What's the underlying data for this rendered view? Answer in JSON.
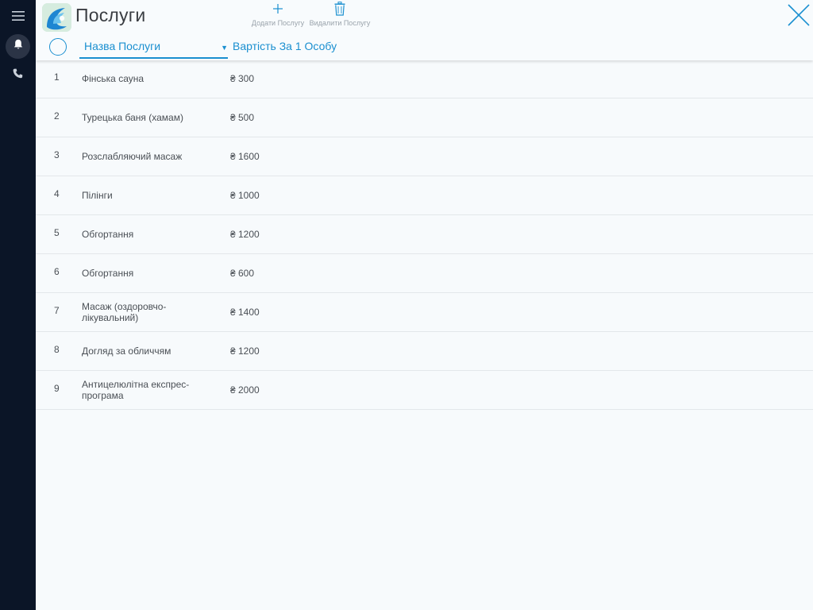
{
  "app": {
    "title": "Послуги"
  },
  "toolbar": {
    "add_label": "Додати Послугу",
    "delete_label": "Видалити Послугу"
  },
  "table": {
    "columns": {
      "name": "Назва Послуги",
      "price": "Вартість За 1 Особу"
    },
    "rows": [
      {
        "num": "1",
        "name": "Фінська сауна",
        "price": "₴ 300"
      },
      {
        "num": "2",
        "name": "Турецька баня (хамам)",
        "price": "₴ 500"
      },
      {
        "num": "3",
        "name": "Розслабляючий масаж",
        "price": "₴ 1600"
      },
      {
        "num": "4",
        "name": "Пілінги",
        "price": "₴ 1000"
      },
      {
        "num": "5",
        "name": "Обгортання",
        "price": "₴ 1200"
      },
      {
        "num": "6",
        "name": "Обгортання",
        "price": "₴ 600"
      },
      {
        "num": "7",
        "name": "Масаж (оздоровчо-лікувальний)",
        "price": "₴ 1400"
      },
      {
        "num": "8",
        "name": "Догляд за обличчям",
        "price": "₴ 1200"
      },
      {
        "num": "9",
        "name": "Антицелюлітна експрес-програма",
        "price": "₴ 2000"
      }
    ]
  },
  "icons": {
    "menu": "menu-icon",
    "bell": "bell-icon",
    "phone": "phone-icon",
    "add": "plus-icon",
    "delete": "trash-icon",
    "close": "close-icon"
  },
  "colors": {
    "accent": "#1a8fd0",
    "sidebar": "#0b1527",
    "background": "#f7fafc"
  }
}
